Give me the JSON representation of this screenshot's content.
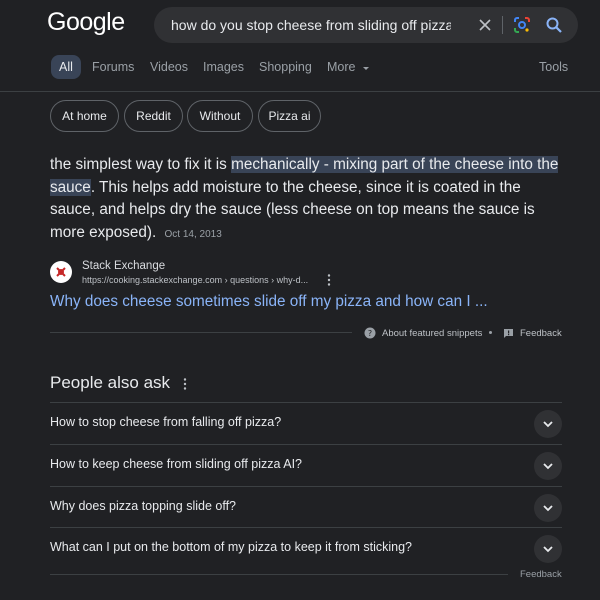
{
  "header": {
    "logo_text": "Google",
    "search": {
      "value": "how do you stop cheese from sliding off pizza",
      "icons": [
        "close-icon",
        "google-lens-icon",
        "search-icon"
      ]
    }
  },
  "tabs": [
    {
      "label": "All",
      "active": true
    },
    {
      "label": "Forums"
    },
    {
      "label": "Videos"
    },
    {
      "label": "Images"
    },
    {
      "label": "Shopping"
    },
    {
      "label": "More"
    }
  ],
  "tools_label": "Tools",
  "chips": [
    "At home",
    "Reddit",
    "Without",
    "Pizza ai"
  ],
  "featured_snippet": {
    "text_before": "the simplest way to fix it is ",
    "text_highlight": "mechanically - mixing part of the cheese into the sauce",
    "text_after": ". This helps add moisture to the cheese, since it is coated in the sauce, and helps dry the sauce (less cheese on top means the sauce is more exposed).",
    "date": "Oct 14, 2013",
    "source_name": "Stack Exchange",
    "source_url": "https://cooking.stackexchange.com › questions › why-d...",
    "link_text": "Why does cheese sometimes slide off my pizza and how can I ...",
    "about_label": "About featured snippets",
    "feedback_label": "Feedback"
  },
  "people_also_ask": {
    "title": "People also ask",
    "questions": [
      "How to stop cheese from falling off pizza?",
      "How to keep cheese from sliding off pizza AI?",
      "Why does pizza topping slide off?",
      "What can I put on the bottom of my pizza to keep it from sticking?"
    ],
    "feedback_label": "Feedback"
  },
  "colors": {
    "background": "#202124",
    "link": "#8ab4f8",
    "highlight": "#394457",
    "text": "#e8eaed"
  }
}
